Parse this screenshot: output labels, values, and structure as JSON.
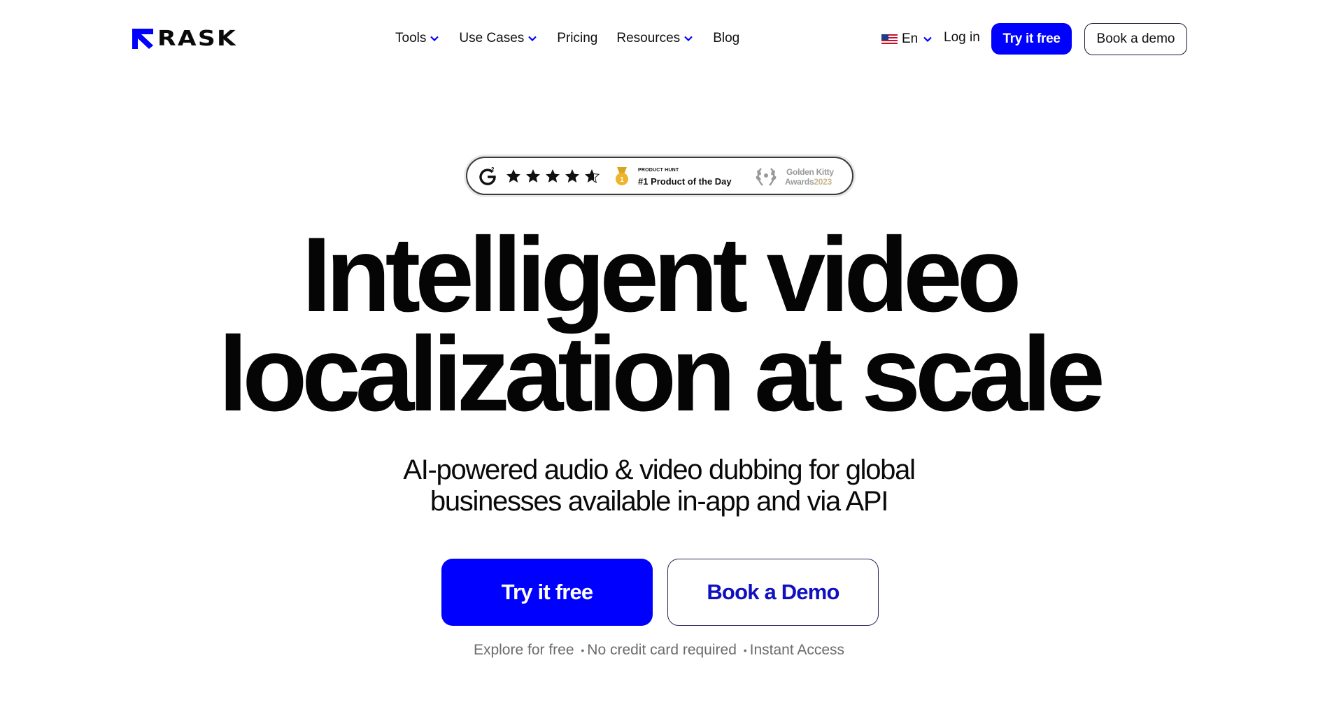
{
  "header": {
    "logo_text": "RASK",
    "nav": {
      "tools": "Tools",
      "use_cases": "Use Cases",
      "pricing": "Pricing",
      "resources": "Resources",
      "blog": "Blog"
    },
    "language": "En",
    "login": "Log in",
    "try_free": "Try it free",
    "book_demo": "Book a demo"
  },
  "awards": {
    "g2_rating_stars": 4.5,
    "product_hunt_small": "PRODUCT HUNT",
    "product_hunt_main": "#1 Product of the Day",
    "golden_kitty_line1": "Golden Kitty",
    "golden_kitty_line2": "Awards",
    "golden_kitty_year": "2023"
  },
  "hero": {
    "headline_line1": "Intelligent video",
    "headline_line2": "localization at scale",
    "subhead_line1": "AI-powered audio & video dubbing for global",
    "subhead_line2": "businesses available in-app and via API",
    "cta_primary": "Try it free",
    "cta_secondary": "Book a Demo",
    "tagline": {
      "part1": "Explore for free",
      "part2": "No credit card required",
      "part3": "Instant Access",
      "separator": "•"
    }
  },
  "colors": {
    "brand_blue": "#0000ff",
    "text_dark": "#0a0a0a",
    "muted": "#6b6b6b"
  }
}
